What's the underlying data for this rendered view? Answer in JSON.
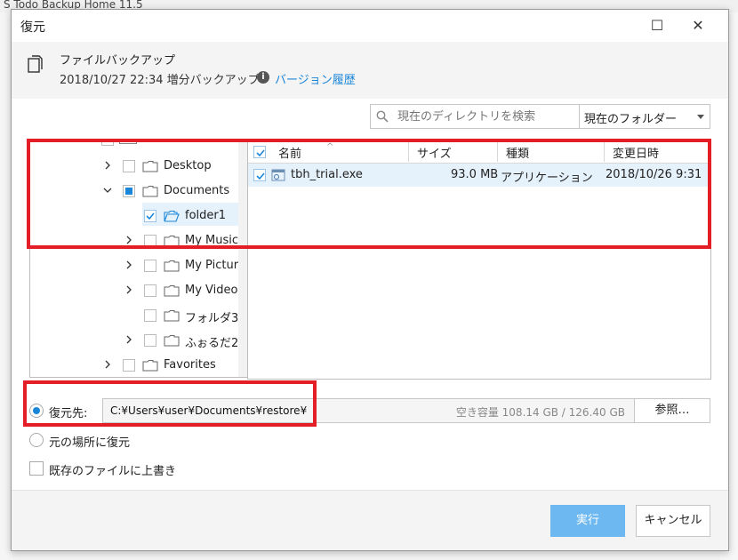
{
  "background_app": {
    "title": "S Todo Backup Home 11.5"
  },
  "dialog": {
    "title": "復元",
    "minimize": "☐",
    "close": "✕"
  },
  "header": {
    "backup_name": "ファイルバックアップ",
    "backup_info": "2018/10/27 22:34 増分バックアップ",
    "history_link": "バージョン履歴"
  },
  "search": {
    "placeholder": "現在のディレクトリを検索",
    "scope_selected": "現在のフォルダー"
  },
  "tree": {
    "items": [
      {
        "label": "Desktop",
        "expander": "›",
        "checked": false
      },
      {
        "label": "Documents",
        "expander": "⌄",
        "checked": "partial"
      },
      {
        "label": "folder1",
        "expander": "",
        "checked": true
      },
      {
        "label": "My Music",
        "expander": "›",
        "checked": false
      },
      {
        "label": "My Picture",
        "expander": "›",
        "checked": false
      },
      {
        "label": "My Videos",
        "expander": "›",
        "checked": false
      },
      {
        "label": "フォルダ3",
        "expander": "",
        "checked": false
      },
      {
        "label": "ふぉるだ2",
        "expander": "›",
        "checked": false
      },
      {
        "label": "Favorites",
        "expander": "›",
        "checked": false
      }
    ]
  },
  "file_list": {
    "columns": {
      "name": "名前",
      "size": "サイズ",
      "type": "種類",
      "modified": "変更日時"
    },
    "rows": [
      {
        "name": "tbh_trial.exe",
        "size": "93.0 MB",
        "type": "アプリケーション",
        "modified": "2018/10/26 9:31",
        "checked": true
      }
    ]
  },
  "destination": {
    "label": "復元先:",
    "path": "C:¥Users¥user¥Documents¥restore¥",
    "free_space": "空き容量 108.14 GB / 126.40 GB",
    "browse": "参照…",
    "original_location": "元の場所に復元",
    "overwrite": "既存のファイルに上書き"
  },
  "footer": {
    "run": "実行",
    "cancel": "キャンセル"
  },
  "colors": {
    "accent": "#1a86d8",
    "highlight": "#e41e26",
    "run_button": "#6db8f0"
  }
}
